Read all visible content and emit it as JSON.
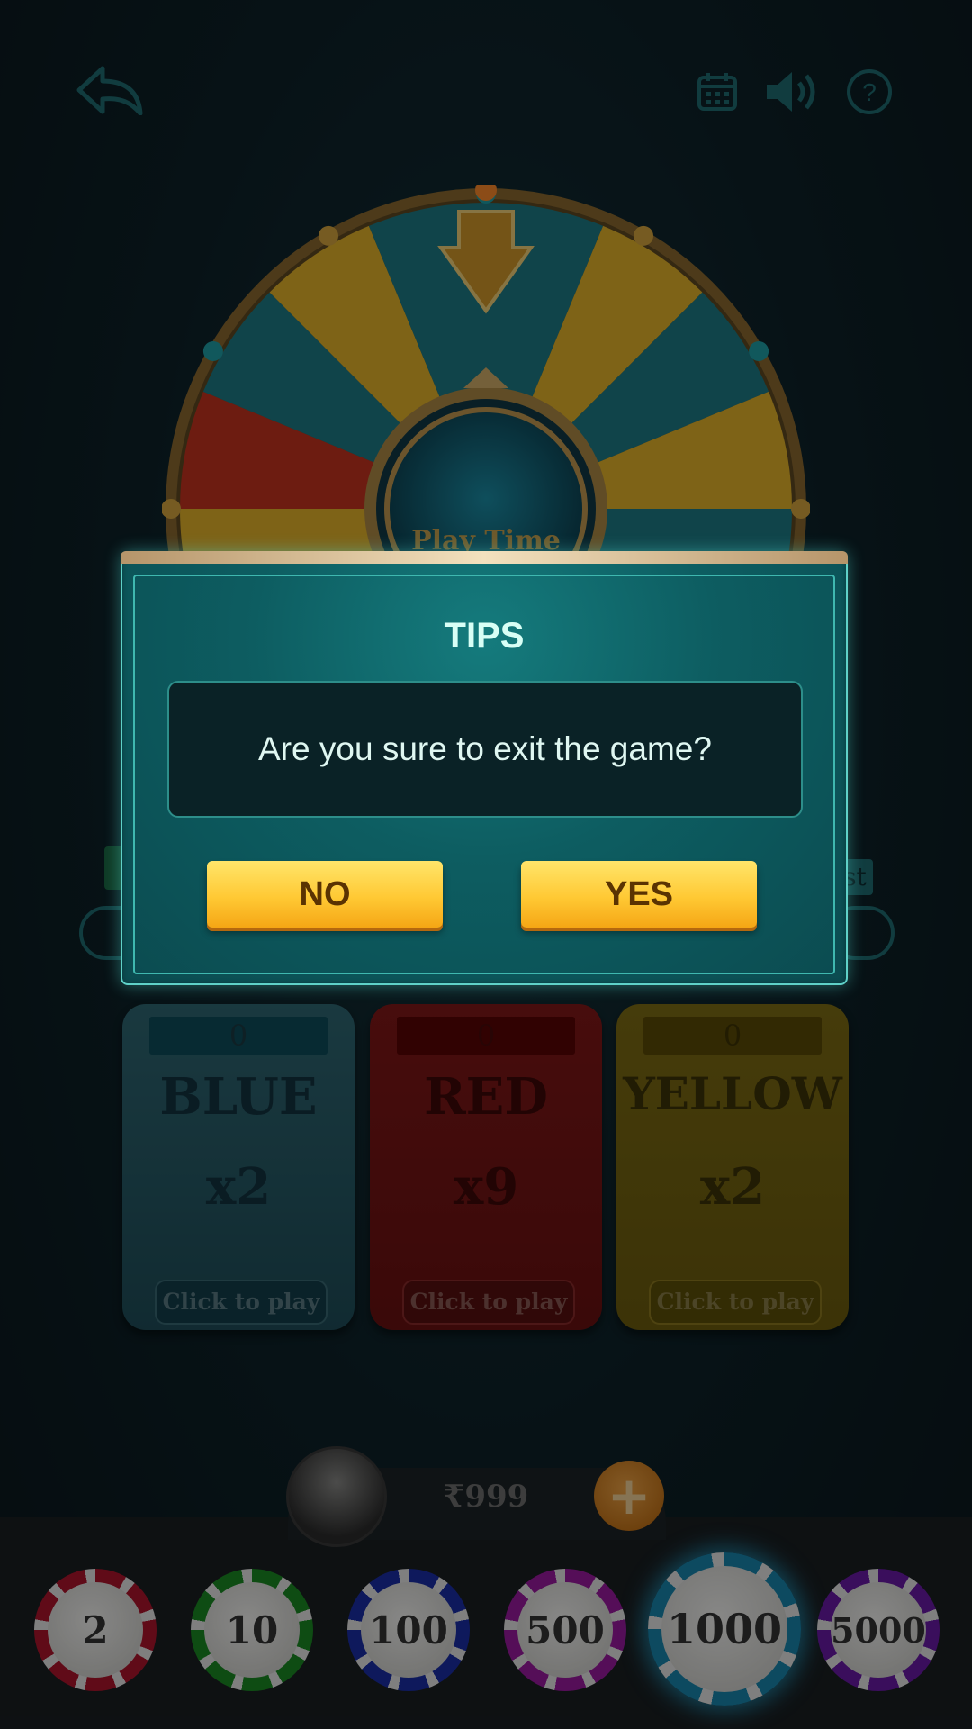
{
  "wheel": {
    "center_label": "Play Time"
  },
  "bets": [
    {
      "name": "BLUE",
      "count": "0",
      "multiplier": "x2",
      "action": "Click to play"
    },
    {
      "name": "RED",
      "count": "0",
      "multiplier": "x9",
      "action": "Click to play"
    },
    {
      "name": "YELLOW",
      "count": "0",
      "multiplier": "x2",
      "action": "Click to play"
    }
  ],
  "wallet": {
    "balance": "₹999"
  },
  "chips": [
    "2",
    "10",
    "100",
    "500",
    "1000",
    "5000"
  ],
  "selected_chip": "1000",
  "hidden_side_label": "st",
  "dialog": {
    "title": "TIPS",
    "message": "Are you sure to exit the game?",
    "no_label": "NO",
    "yes_label": "YES"
  },
  "icons": {
    "back": "back-arrow-icon",
    "calendar": "calendar-icon",
    "sound": "speaker-icon",
    "help": "help-icon",
    "add": "plus-icon"
  },
  "colors": {
    "accent_teal": "#0d5d61",
    "button_yellow": "#ffc934",
    "blue_card": "#2a5b67",
    "red_card": "#7a1717",
    "yellow_card": "#7d6b12"
  }
}
